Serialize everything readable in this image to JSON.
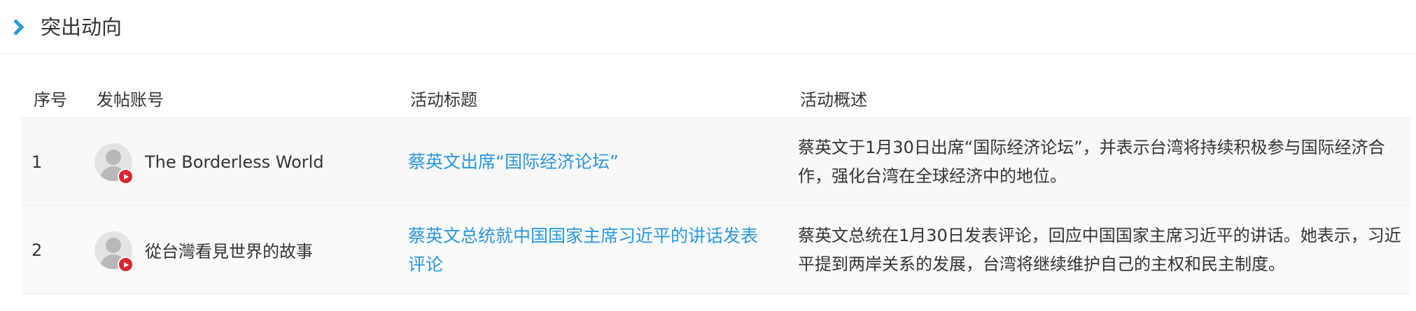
{
  "section": {
    "title": "突出动向",
    "icon": "chevron-right-icon",
    "accent": "#2996e0"
  },
  "table": {
    "headers": {
      "index": "序号",
      "account": "发帖账号",
      "title": "活动标题",
      "summary": "活动概述"
    },
    "rows": [
      {
        "index": "1",
        "account": "The Borderless World",
        "platform": "youtube-icon",
        "title": "蔡英文出席“国际经济论坛”",
        "summary": "蔡英文于1月30日出席“国际经济论坛”，并表示台湾将持续积极参与国际经济合作，强化台湾在全球经济中的地位。"
      },
      {
        "index": "2",
        "account": "從台灣看見世界的故事",
        "platform": "youtube-icon",
        "title": "蔡英文总统就中国国家主席习近平的讲话发表评论",
        "summary": "蔡英文总统在1月30日发表评论，回应中国国家主席习近平的讲话。她表示，习近平提到两岸关系的发展，台湾将继续维护自己的主权和民主制度。"
      }
    ]
  }
}
